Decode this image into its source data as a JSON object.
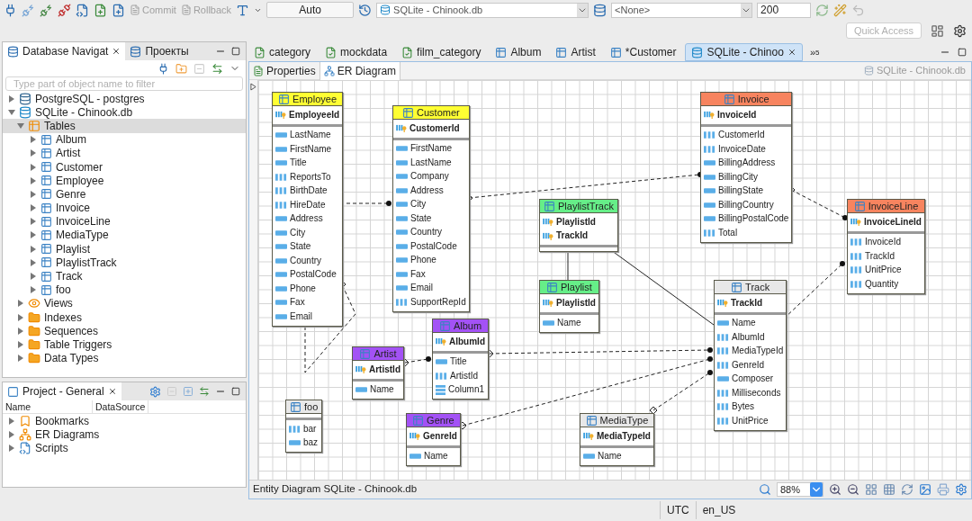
{
  "toolbar": {
    "buttons": [
      {
        "label": "Commit",
        "disabled": true
      },
      {
        "label": "Rollback",
        "disabled": true
      }
    ],
    "commit_mode": "Auto",
    "datasource": "SQLite - Chinook.db",
    "schema": "<None>",
    "result_limit": "200"
  },
  "quick_access": {
    "placeholder": "Quick Access"
  },
  "navigator": {
    "tabs": [
      {
        "label": "Database Navigat",
        "selected": true
      },
      {
        "label": "Проекты",
        "selected": false
      }
    ],
    "filter": {
      "placeholder": "Type part of object name to filter"
    },
    "tree": [
      {
        "label": "PostgreSQL - postgres",
        "kind": "postgres",
        "expanded": false,
        "selected": false
      },
      {
        "label": "SQLite - Chinook.db",
        "kind": "sqlite",
        "expanded": true,
        "selected": false,
        "children": [
          {
            "label": "Tables",
            "kind": "tables",
            "expanded": true,
            "selected": true,
            "children": [
              {
                "label": "Album",
                "kind": "table",
                "expanded": false,
                "selected": false
              },
              {
                "label": "Artist",
                "kind": "table",
                "expanded": false,
                "selected": false
              },
              {
                "label": "Customer",
                "kind": "table",
                "expanded": false,
                "selected": false
              },
              {
                "label": "Employee",
                "kind": "table",
                "expanded": false,
                "selected": false
              },
              {
                "label": "Genre",
                "kind": "table",
                "expanded": false,
                "selected": false
              },
              {
                "label": "Invoice",
                "kind": "table",
                "expanded": false,
                "selected": false
              },
              {
                "label": "InvoiceLine",
                "kind": "table",
                "expanded": false,
                "selected": false
              },
              {
                "label": "MediaType",
                "kind": "table",
                "expanded": false,
                "selected": false
              },
              {
                "label": "Playlist",
                "kind": "table",
                "expanded": false,
                "selected": false
              },
              {
                "label": "PlaylistTrack",
                "kind": "table",
                "expanded": false,
                "selected": false
              },
              {
                "label": "Track",
                "kind": "table",
                "expanded": false,
                "selected": false
              },
              {
                "label": "foo",
                "kind": "table",
                "expanded": false,
                "selected": false
              }
            ]
          },
          {
            "label": "Views",
            "kind": "views",
            "expanded": false,
            "selected": false
          },
          {
            "label": "Indexes",
            "kind": "folder",
            "expanded": false,
            "selected": false
          },
          {
            "label": "Sequences",
            "kind": "folder",
            "expanded": false,
            "selected": false
          },
          {
            "label": "Table Triggers",
            "kind": "folder",
            "expanded": false,
            "selected": false
          },
          {
            "label": "Data Types",
            "kind": "folder",
            "expanded": false,
            "selected": false
          }
        ]
      }
    ]
  },
  "project": {
    "title": "Project - General",
    "columns": [
      "Name",
      "DataSource"
    ],
    "items": [
      {
        "label": "Bookmarks",
        "kind": "bookmarks",
        "expanded": false
      },
      {
        "label": "ER Diagrams",
        "kind": "diagrams",
        "expanded": false
      },
      {
        "label": "Scripts",
        "kind": "scripts",
        "expanded": false
      }
    ]
  },
  "editor_tabs": [
    {
      "label": "category",
      "kind": "sql",
      "selected": false
    },
    {
      "label": "mockdata",
      "kind": "sql",
      "selected": false
    },
    {
      "label": "film_category",
      "kind": "sql",
      "selected": false
    },
    {
      "label": "Album",
      "kind": "table",
      "selected": false
    },
    {
      "label": "Artist",
      "kind": "table",
      "selected": false
    },
    {
      "label": "*Customer",
      "kind": "table",
      "selected": false
    },
    {
      "label": "SQLite - Chinoo",
      "kind": "diagram",
      "selected": true
    }
  ],
  "tab_overflow": {
    "icon": "»",
    "count": "5"
  },
  "subtabs": [
    {
      "label": "Properties",
      "selected": false
    },
    {
      "label": "ER Diagram",
      "selected": true
    }
  ],
  "diagram": {
    "source_label": "SQLite - Chinook.db",
    "entities": [
      {
        "name": "Employee",
        "color": "#ffff33",
        "keys": [
          "EmployeeId"
        ],
        "columns": [
          {
            "name": "LastName",
            "kind": "string"
          },
          {
            "name": "FirstName",
            "kind": "string"
          },
          {
            "name": "Title",
            "kind": "string"
          },
          {
            "name": "ReportsTo",
            "kind": "numeric"
          },
          {
            "name": "BirthDate",
            "kind": "numeric"
          },
          {
            "name": "HireDate",
            "kind": "numeric"
          },
          {
            "name": "Address",
            "kind": "string"
          },
          {
            "name": "City",
            "kind": "string"
          },
          {
            "name": "State",
            "kind": "string"
          },
          {
            "name": "Country",
            "kind": "string"
          },
          {
            "name": "PostalCode",
            "kind": "string"
          },
          {
            "name": "Phone",
            "kind": "string"
          },
          {
            "name": "Fax",
            "kind": "string"
          },
          {
            "name": "Email",
            "kind": "string"
          }
        ]
      },
      {
        "name": "foo",
        "color": "#e8e8e8",
        "columns": [
          {
            "name": "bar",
            "kind": "numeric"
          },
          {
            "name": "baz",
            "kind": "string"
          }
        ]
      },
      {
        "name": "Customer",
        "color": "#ffff33",
        "keys": [
          "CustomerId"
        ],
        "columns": [
          {
            "name": "FirstName",
            "kind": "string"
          },
          {
            "name": "LastName",
            "kind": "string"
          },
          {
            "name": "Company",
            "kind": "string"
          },
          {
            "name": "Address",
            "kind": "string"
          },
          {
            "name": "City",
            "kind": "string"
          },
          {
            "name": "State",
            "kind": "string"
          },
          {
            "name": "Country",
            "kind": "string"
          },
          {
            "name": "PostalCode",
            "kind": "string"
          },
          {
            "name": "Phone",
            "kind": "string"
          },
          {
            "name": "Fax",
            "kind": "string"
          },
          {
            "name": "Email",
            "kind": "string"
          },
          {
            "name": "SupportRepId",
            "kind": "numeric"
          }
        ]
      },
      {
        "name": "Artist",
        "color": "#a352f5",
        "keys": [
          "ArtistId"
        ],
        "columns": [
          {
            "name": "Name",
            "kind": "string"
          }
        ]
      },
      {
        "name": "Album",
        "color": "#a352f5",
        "keys": [
          "AlbumId"
        ],
        "columns": [
          {
            "name": "Title",
            "kind": "string"
          },
          {
            "name": "ArtistId",
            "kind": "numeric"
          },
          {
            "name": "Column1",
            "kind": "binary"
          }
        ]
      },
      {
        "name": "Genre",
        "color": "#a352f5",
        "keys": [
          "GenreId"
        ],
        "columns": [
          {
            "name": "Name",
            "kind": "string"
          }
        ]
      },
      {
        "name": "PlaylistTrack",
        "color": "#66ee88",
        "keys": [
          "PlaylistId",
          "TrackId"
        ]
      },
      {
        "name": "Playlist",
        "color": "#66ee88",
        "keys": [
          "PlaylistId"
        ],
        "columns": [
          {
            "name": "Name",
            "kind": "string"
          }
        ]
      },
      {
        "name": "MediaType",
        "color": "#e8e8e8",
        "keys": [
          "MediaTypeId"
        ],
        "columns": [
          {
            "name": "Name",
            "kind": "string"
          }
        ]
      },
      {
        "name": "Invoice",
        "color": "#f7845f",
        "keys": [
          "InvoiceId"
        ],
        "columns": [
          {
            "name": "CustomerId",
            "kind": "numeric"
          },
          {
            "name": "InvoiceDate",
            "kind": "numeric"
          },
          {
            "name": "BillingAddress",
            "kind": "string"
          },
          {
            "name": "BillingCity",
            "kind": "string"
          },
          {
            "name": "BillingState",
            "kind": "string"
          },
          {
            "name": "BillingCountry",
            "kind": "string"
          },
          {
            "name": "BillingPostalCode",
            "kind": "string"
          },
          {
            "name": "Total",
            "kind": "numeric"
          }
        ]
      },
      {
        "name": "Track",
        "color": "#e8e8e8",
        "keys": [
          "TrackId"
        ],
        "columns": [
          {
            "name": "Name",
            "kind": "string"
          },
          {
            "name": "AlbumId",
            "kind": "numeric"
          },
          {
            "name": "MediaTypeId",
            "kind": "numeric"
          },
          {
            "name": "GenreId",
            "kind": "numeric"
          },
          {
            "name": "Composer",
            "kind": "string"
          },
          {
            "name": "Milliseconds",
            "kind": "numeric"
          },
          {
            "name": "Bytes",
            "kind": "numeric"
          },
          {
            "name": "UnitPrice",
            "kind": "numeric"
          }
        ]
      },
      {
        "name": "InvoiceLine",
        "color": "#f7845f",
        "keys": [
          "InvoiceLineId"
        ],
        "columns": [
          {
            "name": "InvoiceId",
            "kind": "numeric"
          },
          {
            "name": "TrackId",
            "kind": "numeric"
          },
          {
            "name": "UnitPrice",
            "kind": "numeric"
          },
          {
            "name": "Quantity",
            "kind": "numeric"
          }
        ]
      }
    ],
    "footer": "Entity Diagram SQLite - Chinook.db",
    "zoom": "88%"
  },
  "status_bar": [
    "UTC",
    "en_US"
  ]
}
